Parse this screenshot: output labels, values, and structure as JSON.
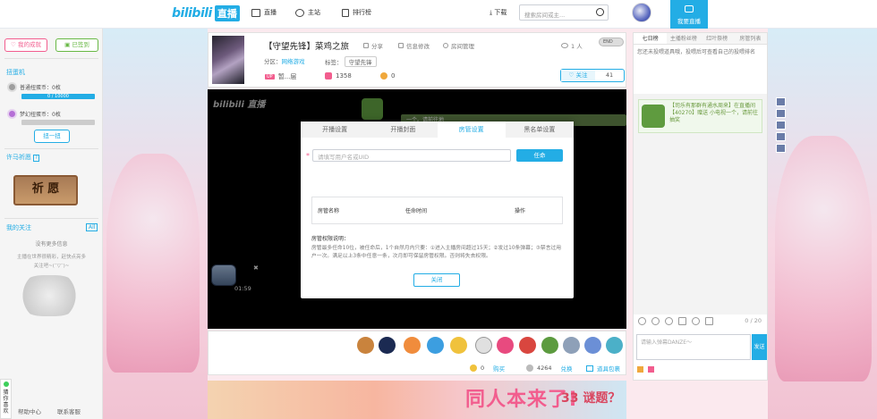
{
  "topbar": {
    "logo_word": "bilibili",
    "logo_live": "直播",
    "nav": [
      {
        "label": "直播",
        "icon": "tv-icon"
      },
      {
        "label": "主站",
        "icon": "site-icon"
      },
      {
        "label": "排行榜",
        "icon": "rank-icon"
      }
    ],
    "download": "下载",
    "search_placeholder": "搜索房间或主...",
    "live_button": "我要直播"
  },
  "left": {
    "my_achievement": "我的成就",
    "signed": "已签到",
    "capsule_title": "扭蛋机",
    "normal_capsule": "普通扭蛋币：0枚",
    "normal_progress": "0 / 10000",
    "dream_capsule": "梦幻扭蛋币：0枚",
    "twist_button": "扭一扭",
    "wish_title": "许马祈愿",
    "wish_board": "祈 愿",
    "follow_title": "我的关注",
    "follow_all": "All",
    "follow_empty_1": "没有更多信息",
    "follow_empty_2": "主播在世界很精彩，赶快点亮多",
    "follow_empty_3": "关注吧~(¯▽¯)~",
    "help": "帮助中心",
    "contact": "联系客服",
    "float_tab": "猜你喜欢"
  },
  "room": {
    "title": "【守望先锋】菜鸡之旅",
    "share": "分享",
    "info_edit": "信息修改",
    "room_manage": "房间管理",
    "viewers": "1 人",
    "end_toggle": "END",
    "area_label": "分区：",
    "area_value": "网络游戏",
    "tag_label": "标签：",
    "tag_value": "守望先锋",
    "level_badge": "UP",
    "rank_text": "暂...层",
    "gold_count": "1358",
    "silver_count": "0",
    "follow_label": "关注",
    "follow_count": "41"
  },
  "player": {
    "logo": "bilibili 直播",
    "timer": "01:59",
    "danmu": "一个。请前往地"
  },
  "modal": {
    "tabs": [
      "开播设置",
      "开播封面",
      "房管设置",
      "黑名单设置"
    ],
    "active_tab": 2,
    "input_placeholder": "请填写用户名或UID",
    "appoint_button": "任命",
    "table_headers": [
      "房管名称",
      "任命时间",
      "操作"
    ],
    "rules_title": "房管权限说明：",
    "rules_text": "房管最多任命10位，被任命后，1个自然月内只要：①进入主播房间超过15天；②发过10条弹幕；③禁言过用户一次。满足以上3条中任意一条，次月即可保留房管权限。否则将失去权限。",
    "close_button": "关闭"
  },
  "giftbar": {
    "silver_value": "0",
    "buy": "购买",
    "gold_value": "4264",
    "exchange": "兑换",
    "package": "道具包裹"
  },
  "banner": {
    "text": "同人本来了!",
    "text2": "33 谜题？"
  },
  "rightpanel": {
    "tabs": [
      "七日榜",
      "主播粉丝榜",
      "红叶祭榜",
      "房管列表"
    ],
    "note": "您还未投喂道具哦，投喂后可查看自己的投喂排名",
    "gift_message": "【司乐有那群有通水周来】在直播间【40270】赠送 小电视一个，请前往抽奖",
    "counter": "0 / 20",
    "input_placeholder": "请输入弹幕DANZE～",
    "send": "发送"
  }
}
